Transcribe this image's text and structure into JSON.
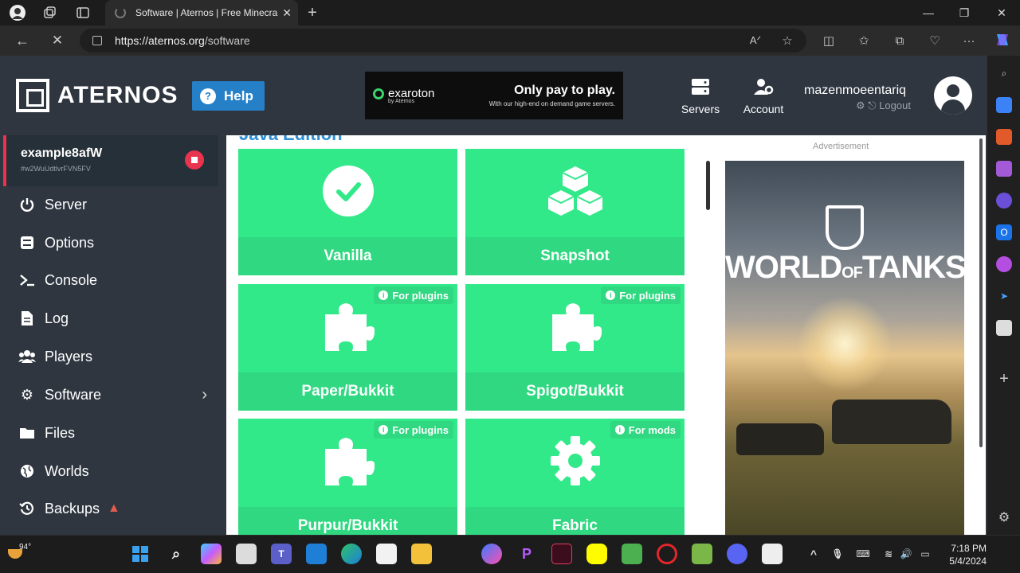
{
  "browser": {
    "tab_title": "Software | Aternos | Free Minecra",
    "url_host": "https://aternos.org",
    "url_path": "/software"
  },
  "header": {
    "logo_text": "ATERNOS",
    "help_label": "Help",
    "banner": {
      "brand": "exaroton",
      "brand_sub": "by Aternos",
      "headline": "Only pay to play.",
      "subline": "With our high-end on demand game servers."
    },
    "nav": [
      {
        "label": "Servers",
        "icon": "servers-icon"
      },
      {
        "label": "Account",
        "icon": "account-icon"
      }
    ],
    "username": "mazenmoeentariq",
    "logout_label": "Logout"
  },
  "server": {
    "name": "example8afW",
    "id": "#w2WuUdtlvrFVN5FV"
  },
  "sidebar": {
    "items": [
      {
        "label": "Server",
        "icon": "power-icon"
      },
      {
        "label": "Options",
        "icon": "sliders-icon"
      },
      {
        "label": "Console",
        "icon": "terminal-icon"
      },
      {
        "label": "Log",
        "icon": "file-icon"
      },
      {
        "label": "Players",
        "icon": "users-icon"
      },
      {
        "label": "Software",
        "icon": "gears-icon"
      },
      {
        "label": "Files",
        "icon": "folder-icon"
      },
      {
        "label": "Worlds",
        "icon": "globe-icon"
      },
      {
        "label": "Backups",
        "icon": "history-icon"
      }
    ]
  },
  "content": {
    "section_title": "Java Edition",
    "cards": [
      {
        "name": "Vanilla",
        "icon": "check-circle-icon",
        "badge": ""
      },
      {
        "name": "Snapshot",
        "icon": "cubes-icon",
        "badge": ""
      },
      {
        "name": "Paper/Bukkit",
        "icon": "puzzle-icon",
        "badge": "For plugins"
      },
      {
        "name": "Spigot/Bukkit",
        "icon": "puzzle-icon",
        "badge": "For plugins"
      },
      {
        "name": "Purpur/Bukkit",
        "icon": "puzzle-icon",
        "badge": "For plugins"
      },
      {
        "name": "Fabric",
        "icon": "gear-icon",
        "badge": "For mods"
      }
    ],
    "ad_label": "Advertisement",
    "ad_title": "WORLD",
    "ad_title_of": "OF",
    "ad_title_end": "TANKS"
  },
  "taskbar": {
    "temperature": "94°",
    "time": "7:18 PM",
    "date": "5/4/2024"
  },
  "colors": {
    "card_green": "#32e98a",
    "card_green_dark": "#2fd881",
    "sidebar_bg": "#2f3640",
    "help_blue": "#2580c8",
    "stop_red": "#e8344e"
  }
}
